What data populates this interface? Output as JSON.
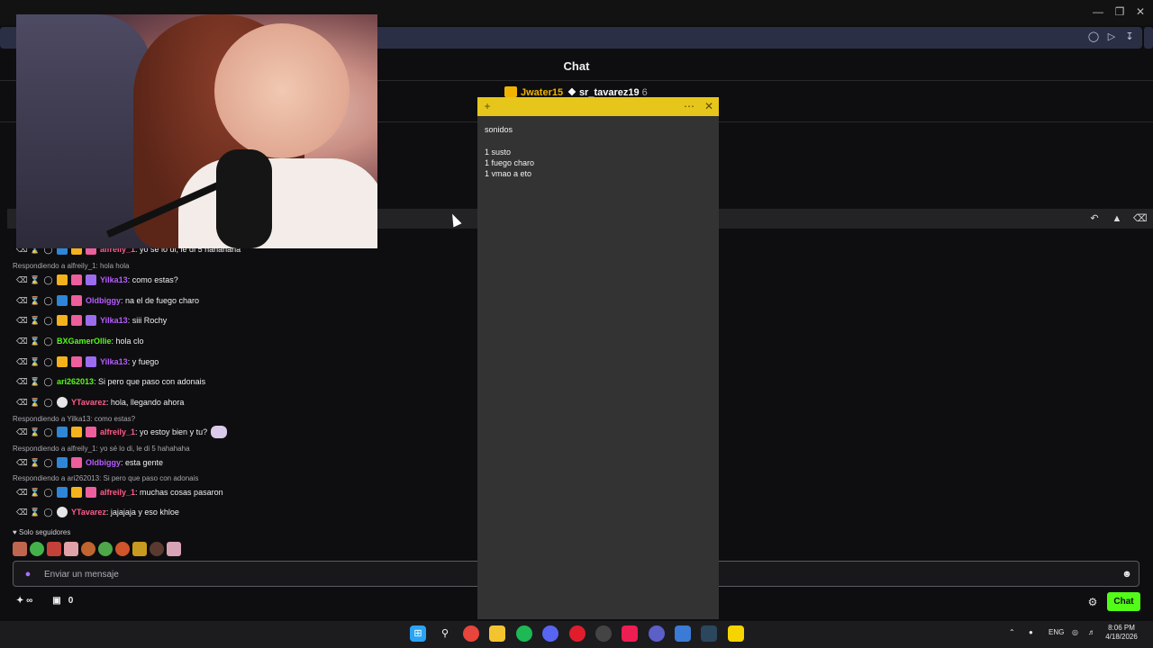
{
  "window": {
    "minimize_icon": "minimize-icon",
    "restore_icon": "restore-icon",
    "close_icon": "close-icon"
  },
  "header": {
    "title": "Chat"
  },
  "gifters": [
    {
      "name": "Jwater15",
      "color": "#f0b400"
    },
    {
      "name": "sr_tavarez19",
      "count": "6",
      "color": "#ffffff"
    }
  ],
  "messages": [
    {
      "user": "alfreily_1",
      "color": "#ff5c8a",
      "text": ": yo se lo di, le di 5 hahahaha"
    },
    {
      "reply": "Respondiendo a alfreily_1: hola hola"
    },
    {
      "user": "Yilka13",
      "color": "#b65cff",
      "text": ": como estas?"
    },
    {
      "user": "Oldbiggy",
      "color": "#b65cff",
      "text": ": na el de fuego charo"
    },
    {
      "user": "Yilka13",
      "color": "#b65cff",
      "text": ": siii Rochy"
    },
    {
      "user": "BXGamerOllie",
      "color": "#53fc18",
      "text": ": hola clo"
    },
    {
      "user": "Yilka13",
      "color": "#b65cff",
      "text": ": y fuego"
    },
    {
      "user": "ari262013",
      "color": "#53fc18",
      "text": ": Si pero que paso con adonais"
    },
    {
      "user": "YTavarez",
      "color": "#ff5c8a",
      "text": ": hola, llegando ahora"
    },
    {
      "reply": "Respondiendo a Yilka13: como estas?"
    },
    {
      "user": "alfreily_1",
      "color": "#ff5c8a",
      "text": ": yo estoy bien y tu?"
    },
    {
      "reply": "Respondiendo a alfreily_1: yo sé lo di, le di 5 hahahaha"
    },
    {
      "user": "Oldbiggy",
      "color": "#b65cff",
      "text": ": esta gente"
    },
    {
      "reply": "Respondiendo a ari262013: Si pero que paso con adonais"
    },
    {
      "user": "alfreily_1",
      "color": "#ff5c8a",
      "text": ": muchas cosas pasaron"
    },
    {
      "user": "YTavarez",
      "color": "#ff5c8a",
      "text": ": jajajaja y eso khloe"
    }
  ],
  "followers_only": "Solo seguidores",
  "input": {
    "placeholder": "Enviar un mensaje"
  },
  "bottom": {
    "count": "0",
    "chat_button": "Chat"
  },
  "sticky_note": {
    "text": "sonidos\n\n1 susto\n1 fuego charo\n1 vmao a eto"
  },
  "taskbar": {
    "language": "ENG",
    "time": "8:06 PM",
    "date": "4/18/2026"
  },
  "colors": {
    "accent": "#53fc18",
    "sticky_bar": "#e6c61a",
    "background": "#0e0e10"
  }
}
